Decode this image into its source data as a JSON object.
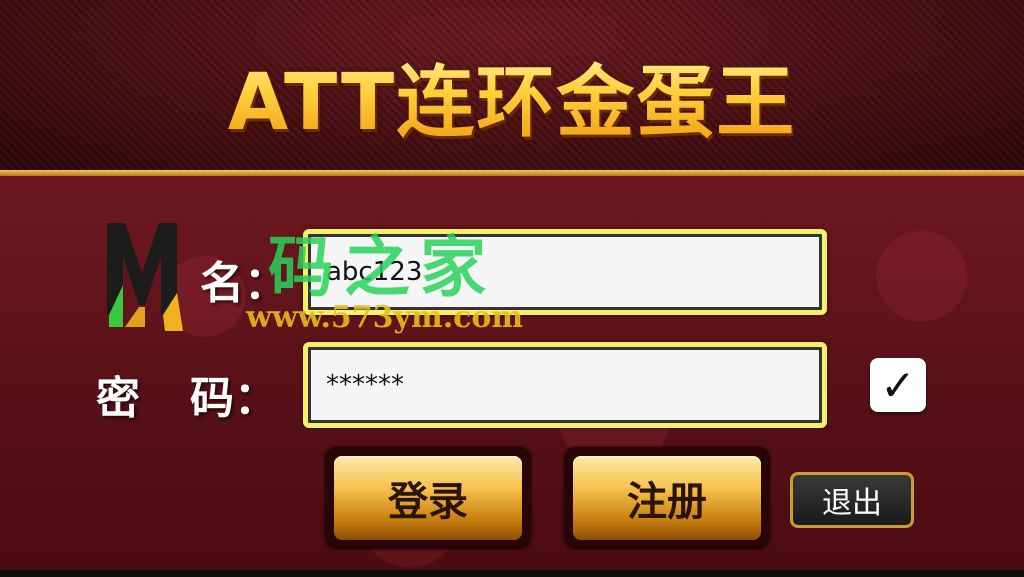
{
  "game": {
    "title": "ATT连环金蛋王"
  },
  "form": {
    "username_label": "名：",
    "username_value": "abc123",
    "password_label_a": "密",
    "password_label_b": "码：",
    "password_value": "******",
    "remember_checked": true
  },
  "buttons": {
    "login": "登录",
    "register": "注册",
    "exit": "退出"
  },
  "watermark": {
    "text_cn": "码之家",
    "url": "www.573ym.com"
  },
  "colors": {
    "title_gold": "#ffd54a",
    "field_border": "#f5f06a",
    "watermark_green": "#28d25a"
  },
  "icons": {
    "checkbox": "check-icon",
    "logo": "m-logo-icon"
  }
}
